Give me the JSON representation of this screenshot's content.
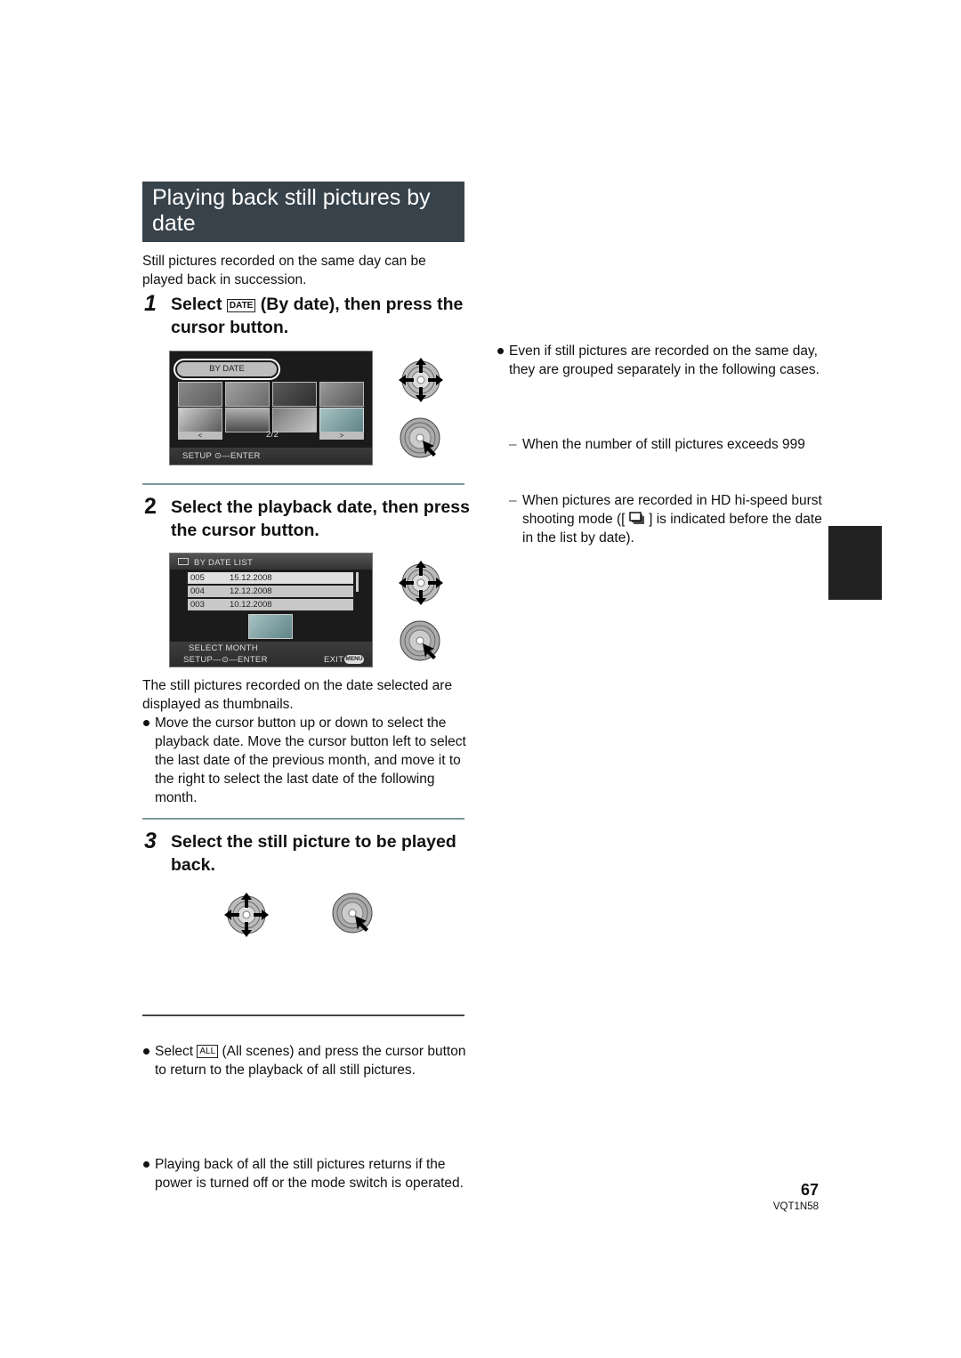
{
  "section_title": "Playing back still pictures by date",
  "intro": "Still pictures recorded on the same day can be played back in succession.",
  "steps": [
    {
      "number": "1",
      "text_before_icon": "Select",
      "icon_label": "DATE",
      "text_after_icon": "(By date), then press the cursor button."
    },
    {
      "number": "2",
      "text": "Select the playback date, then press the cursor button."
    },
    {
      "number": "3",
      "text": "Select the still picture to be played back."
    }
  ],
  "screen1": {
    "menu_label": "BY DATE",
    "page_indicator": "2/2",
    "prev": "<",
    "next": ">",
    "footer": "SETUP  ⊙—ENTER"
  },
  "screen2": {
    "header": "BY DATE LIST",
    "rows": [
      {
        "count": "005",
        "date": "15.12.2008"
      },
      {
        "count": "004",
        "date": "12.12.2008"
      },
      {
        "count": "003",
        "date": "10.12.2008"
      }
    ],
    "select_month": "SELECT MONTH",
    "footer_left": "SETUP—⊙—ENTER",
    "footer_right": "EXIT",
    "menu_badge": "MENU"
  },
  "step2_desc": "The still pictures recorded on the date selected are displayed as thumbnails.",
  "step2_bullet": "Move the cursor button up or down to select the playback date. Move the cursor button left to select the last date of the previous month, and move it to the right to select the last date of the following month.",
  "step3_bullet": {
    "before": "Select",
    "icon_label": "ALL",
    "after": "(All scenes) and press the cursor button to return to the playback of all still pictures."
  },
  "note_bullet": "Playing back of all the still pictures returns if the power is turned off or the mode switch is operated.",
  "right_column": {
    "bullet": "Even if still pictures are recorded on the same day, they are grouped separately in the following cases.",
    "dash1": "When the number of still pictures exceeds 999",
    "dash2_before": "When pictures are recorded in HD hi-speed burst shooting mode ([",
    "dash2_after": "] is indicated before the date in the list by date)."
  },
  "page_number": "67",
  "model_code": "VQT1N58"
}
